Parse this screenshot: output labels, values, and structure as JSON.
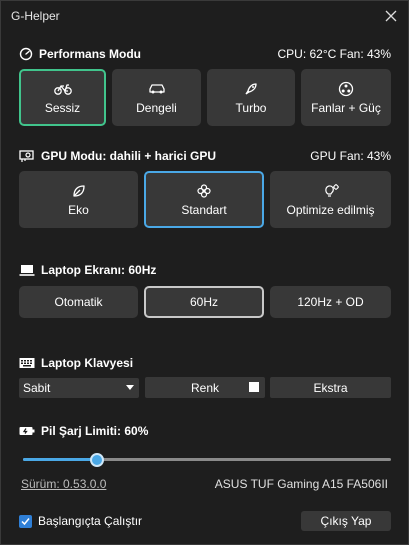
{
  "window": {
    "title": "G-Helper"
  },
  "performance": {
    "title": "Performans Modu",
    "status": "CPU: 62°C  Fan: 43%",
    "modes": [
      {
        "label": "Sessiz",
        "icon": "bicycle-icon",
        "active": true
      },
      {
        "label": "Dengeli",
        "icon": "car-icon",
        "active": false
      },
      {
        "label": "Turbo",
        "icon": "rocket-icon",
        "active": false
      },
      {
        "label": "Fanlar + Güç",
        "icon": "fan-icon",
        "active": false
      }
    ]
  },
  "gpu": {
    "title": "GPU Modu: dahili + harici GPU",
    "status": "GPU Fan: 43%",
    "modes": [
      {
        "label": "Eko",
        "icon": "leaf-icon",
        "active": false
      },
      {
        "label": "Standart",
        "icon": "flower-icon",
        "active": true
      },
      {
        "label": "Optimize edilmiş",
        "icon": "bulb-gear-icon",
        "active": false
      }
    ]
  },
  "screen": {
    "title": "Laptop Ekranı: 60Hz",
    "modes": [
      {
        "label": "Otomatik",
        "active": false
      },
      {
        "label": "60Hz",
        "active": true
      },
      {
        "label": "120Hz + OD",
        "active": false
      }
    ]
  },
  "keyboard": {
    "title": "Laptop Klavyesi",
    "mode_value": "Sabit",
    "color_label": "Renk",
    "color_value": "#ffffff",
    "extra_label": "Ekstra"
  },
  "battery": {
    "title": "Pil Şarj Limiti: 60%",
    "limit": 60,
    "slider_fraction": 0.2
  },
  "footer": {
    "version": "Sürüm: 0.53.0.0",
    "model": "ASUS TUF Gaming A15 FA506II",
    "startup_label": "Başlangıçta Çalıştır",
    "startup_checked": true,
    "quit_label": "Çıkış Yap"
  },
  "colors": {
    "accent_green": "#41c48c",
    "accent_blue": "#4aa8e6",
    "button_bg": "#383838",
    "window_bg": "#1e1e1e"
  }
}
